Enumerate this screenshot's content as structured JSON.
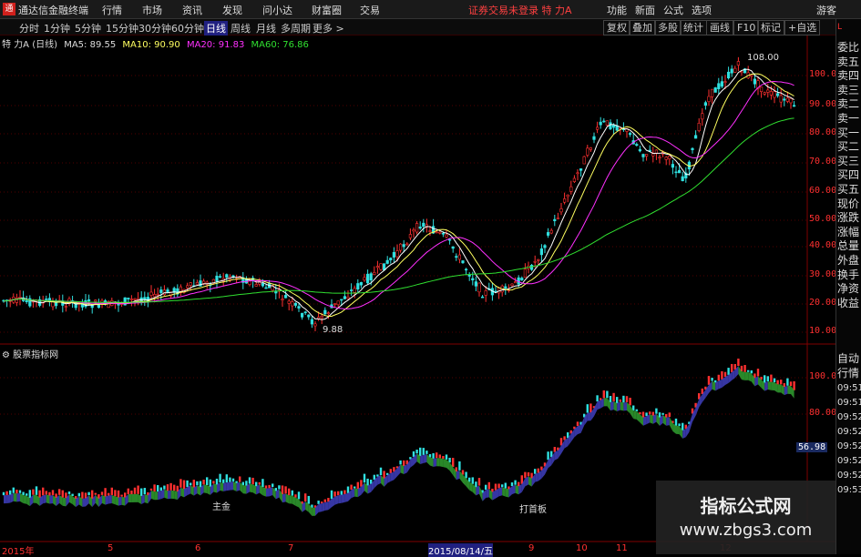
{
  "titlebar": {
    "app_name": "通达信金融终端",
    "menu": [
      "行情",
      "市场",
      "资讯",
      "发现",
      "问小达",
      "财富圈",
      "交易"
    ],
    "notice": "证券交易未登录  特 力A",
    "right_menu": [
      "功能",
      "新面",
      "公式",
      "选项"
    ],
    "guest": "游客"
  },
  "periods": [
    "分时",
    "1分钟",
    "5分钟",
    "15分钟",
    "30分钟",
    "60分钟",
    "日线",
    "周线",
    "月线",
    "多周期",
    "更多 >"
  ],
  "active_period": "日线",
  "right_tools": [
    "复权",
    "叠加",
    "多股",
    "统计",
    "画线",
    "F10",
    "标记",
    "+自选"
  ],
  "info": {
    "stock": "特 力A (日线)",
    "ma5": "MA5: 89.55",
    "ma10": "MA10: 90.90",
    "ma20": "MA20: 91.83",
    "ma60": "MA60: 76.86"
  },
  "price_axis": [
    "100.0",
    "90.00",
    "80.00",
    "70.00",
    "60.00",
    "50.00",
    "40.00",
    "30.00",
    "20.00",
    "10.00"
  ],
  "lower_axis": [
    "100.0",
    "80.00"
  ],
  "lower_value": "56.98",
  "annotations": {
    "high": "108.00",
    "low": "9.88",
    "tag1": "主金",
    "tag2": "打首板"
  },
  "lower_label": "股票指标网",
  "side_panel": [
    "委比",
    "卖五",
    "卖四",
    "卖三",
    "卖二",
    "卖一",
    "买一",
    "买二",
    "买三",
    "买四",
    "买五",
    "现价",
    "涨跌",
    "涨幅",
    "总量",
    "外盘",
    "换手",
    "净资",
    "收益"
  ],
  "side_panel_lower": [
    "自动",
    "行情",
    "09:51",
    "09:51",
    "09:52",
    "09:52",
    "09:52",
    "09:52",
    "09:52",
    "09:53"
  ],
  "x_axis": [
    "2015年",
    "5",
    "6",
    "7",
    "2015/08/14/五",
    "9",
    "10",
    "11",
    "12"
  ],
  "watermark": {
    "line1": "指标公式网",
    "line2": "www.zbgs3.com"
  },
  "colors": {
    "up": "#ff3030",
    "down": "#30e0e0",
    "ma5": "#ffffff",
    "ma10": "#ffff60",
    "ma20": "#ff30ff",
    "ma60": "#30e030"
  }
}
